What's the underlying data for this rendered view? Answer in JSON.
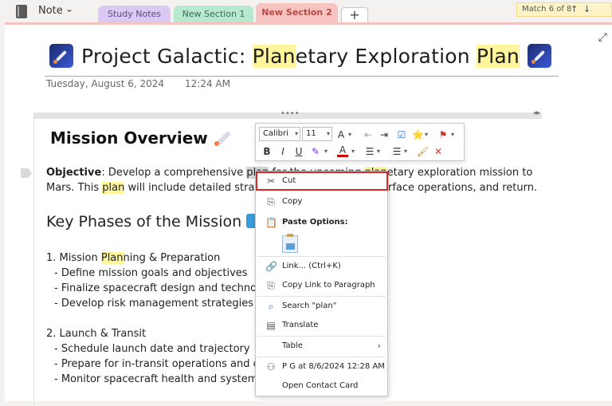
{
  "topbar": {
    "notebook_name": "Note",
    "tabs": [
      "Study Notes",
      "New Section 1",
      "New Section 2"
    ],
    "add_tab": "+",
    "find": {
      "status": "Match 6 of 8",
      "up": "↑",
      "down": "↓"
    }
  },
  "page": {
    "title_part1": "Project Galactic: ",
    "title_hl1": "Plan",
    "title_part2": "etary Exploration ",
    "title_hl2": "Plan",
    "date": "Tuesday, August 6, 2024",
    "time": "12:24 AM"
  },
  "content": {
    "heading1": "Mission Overview",
    "objective_label": "Objective",
    "line1_a": ": Develop a comprehensive ",
    "line1_sel": "plan",
    "line1_b": " for the upcoming ",
    "line1_hl": "plan",
    "line1_c": "etary exploration mission to",
    "line2_a": "Mars. This ",
    "line2_hl": "plan",
    "line2_b": " will include detailed strat",
    "line2_c": "rface operations, and return.",
    "heading2": "Key Phases of the Mission",
    "phase1_a": "1. Mission ",
    "phase1_hl": "Plan",
    "phase1_b": "ning & Preparation",
    "phase1_items": [
      "- Define mission goals and objectives",
      "- Finalize spacecraft design and technolo",
      "- Develop risk management strategies"
    ],
    "phase2": "2. Launch & Transit",
    "phase2_items": [
      "- Schedule launch date and trajectory",
      "- Prepare for in-transit operations and c",
      "- Monitor spacecraft health and system"
    ]
  },
  "mini_toolbar": {
    "font": "Calibri",
    "size": "11",
    "bold": "B",
    "italic": "I",
    "underline": "U"
  },
  "context_menu": {
    "cut": "Cut",
    "copy": "Copy",
    "paste_options": "Paste Options:",
    "link": "Link...  (Ctrl+K)",
    "copy_link": "Copy Link to Paragraph",
    "search": "Search \"plan\"",
    "translate": "Translate",
    "table": "Table",
    "author": "P G at 8/6/2024 12:28 AM",
    "open_contact": "Open Contact Card"
  }
}
